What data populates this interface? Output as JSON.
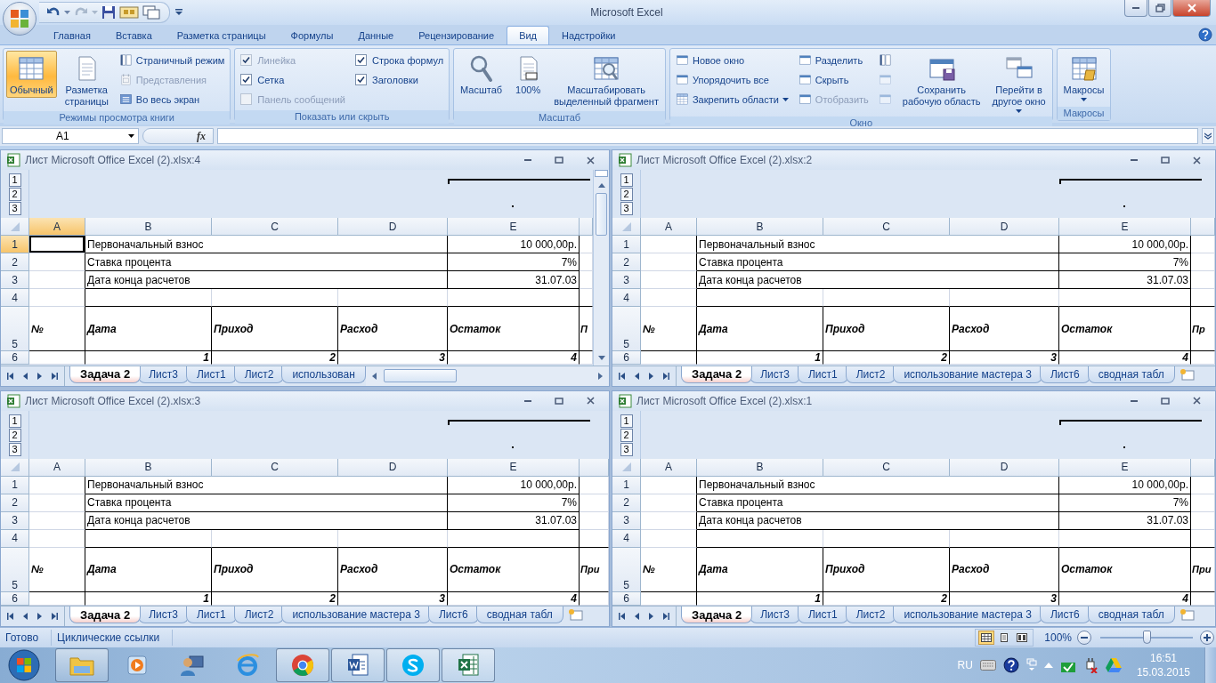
{
  "app": {
    "title": "Microsoft Excel"
  },
  "ribbon_tabs": [
    {
      "label": "Главная",
      "selected": false
    },
    {
      "label": "Вставка",
      "selected": false
    },
    {
      "label": "Разметка страницы",
      "selected": false
    },
    {
      "label": "Формулы",
      "selected": false
    },
    {
      "label": "Данные",
      "selected": false
    },
    {
      "label": "Рецензирование",
      "selected": false
    },
    {
      "label": "Вид",
      "selected": true
    },
    {
      "label": "Надстройки",
      "selected": false
    }
  ],
  "ribbon": {
    "groups": [
      {
        "label": "Режимы просмотра книги",
        "columns": [
          [
            {
              "kind": "large",
              "label": "Обычный",
              "selected": true
            }
          ],
          [
            {
              "kind": "large",
              "label": "Разметка\nстраницы",
              "selected": false
            }
          ],
          [
            {
              "kind": "small",
              "label": "Страничный режим",
              "disabled": false
            },
            {
              "kind": "small",
              "label": "Представления",
              "disabled": true
            },
            {
              "kind": "small",
              "label": "Во весь экран",
              "disabled": false
            }
          ]
        ]
      },
      {
        "label": "Показать или скрыть",
        "columns": [
          [
            {
              "kind": "check",
              "label": "Линейка",
              "checked": true,
              "disabled": true
            },
            {
              "kind": "check",
              "label": "Сетка",
              "checked": true,
              "disabled": false
            },
            {
              "kind": "check",
              "label": "Панель сообщений",
              "checked": false,
              "disabled": true
            }
          ],
          [
            {
              "kind": "check",
              "label": "Строка формул",
              "checked": true,
              "disabled": false
            },
            {
              "kind": "check",
              "label": "Заголовки",
              "checked": true,
              "disabled": false
            }
          ]
        ]
      },
      {
        "label": "Масштаб",
        "columns": [
          [
            {
              "kind": "large",
              "label": "Масштаб"
            }
          ],
          [
            {
              "kind": "large",
              "label": "100%"
            }
          ],
          [
            {
              "kind": "large",
              "label": "Масштабировать\nвыделенный фрагмент"
            }
          ]
        ]
      },
      {
        "label": "Окно",
        "columns": [
          [
            {
              "kind": "small",
              "label": "Новое окно",
              "disabled": false
            },
            {
              "kind": "small",
              "label": "Упорядочить все",
              "disabled": false
            },
            {
              "kind": "small",
              "label": "Закрепить области",
              "disabled": false,
              "dropdown": true
            }
          ],
          [
            {
              "kind": "small",
              "label": "Разделить",
              "disabled": false
            },
            {
              "kind": "small",
              "label": "Скрыть",
              "disabled": false
            },
            {
              "kind": "small",
              "label": "Отобразить",
              "disabled": true
            }
          ],
          [
            {
              "kind": "icon",
              "disabled": false
            },
            {
              "kind": "icon",
              "disabled": true
            },
            {
              "kind": "icon",
              "disabled": true
            }
          ],
          [
            {
              "kind": "large",
              "label": "Сохранить\nрабочую область"
            }
          ],
          [
            {
              "kind": "large",
              "label": "Перейти в\nдругое окно",
              "dropdown": true
            }
          ]
        ]
      },
      {
        "label": "Макросы",
        "columns": [
          [
            {
              "kind": "large",
              "label": "Макросы",
              "dropdown": true
            }
          ]
        ]
      }
    ]
  },
  "formula_bar": {
    "name_box": "A1",
    "function_label": "fx"
  },
  "windows": [
    {
      "title": "Лист Microsoft Office Excel (2).xlsx:4",
      "active": true,
      "vscroll": true,
      "hscroll": true,
      "outline_levels": [
        "1",
        "2",
        "3"
      ],
      "columns": [
        "A",
        "B",
        "C",
        "D",
        "E"
      ],
      "row_numbers": [
        "1",
        "2",
        "3",
        "4",
        "5",
        "6"
      ],
      "info": [
        {
          "label": "Первоначальный взнос",
          "value": "10 000,00р."
        },
        {
          "label": "Ставка процента",
          "value": "7%"
        },
        {
          "label": "Дата конца расчетов",
          "value": "31.07.03"
        }
      ],
      "headings": [
        "№",
        "Дата",
        "Приход",
        "Расход",
        "Остаток",
        "П"
      ],
      "numbers": [
        "1",
        "2",
        "3",
        "4"
      ],
      "sheets": [
        {
          "label": "Задача 2",
          "selected": true
        },
        {
          "label": "Лист3",
          "selected": false
        },
        {
          "label": "Лист1",
          "selected": false
        },
        {
          "label": "Лист2",
          "selected": false
        },
        {
          "label": "использован",
          "selected": false
        }
      ]
    },
    {
      "title": "Лист Microsoft Office Excel (2).xlsx:2",
      "active": false,
      "vscroll": false,
      "hscroll": false,
      "outline_levels": [
        "1",
        "2",
        "3"
      ],
      "columns": [
        "A",
        "B",
        "C",
        "D",
        "E"
      ],
      "row_numbers": [
        "1",
        "2",
        "3",
        "4",
        "5",
        "6"
      ],
      "info": [
        {
          "label": "Первоначальный взнос",
          "value": "10 000,00р."
        },
        {
          "label": "Ставка процента",
          "value": "7%"
        },
        {
          "label": "Дата конца расчетов",
          "value": "31.07.03"
        }
      ],
      "headings": [
        "№",
        "Дата",
        "Приход",
        "Расход",
        "Остаток",
        "Пр"
      ],
      "numbers": [
        "1",
        "2",
        "3",
        "4"
      ],
      "sheets": [
        {
          "label": "Задача 2",
          "selected": true
        },
        {
          "label": "Лист3",
          "selected": false
        },
        {
          "label": "Лист1",
          "selected": false
        },
        {
          "label": "Лист2",
          "selected": false
        },
        {
          "label": "использование мастера 3",
          "selected": false
        },
        {
          "label": "Лист6",
          "selected": false
        },
        {
          "label": "сводная табл",
          "selected": false
        }
      ]
    },
    {
      "title": "Лист Microsoft Office Excel (2).xlsx:3",
      "active": false,
      "vscroll": false,
      "hscroll": false,
      "outline_levels": [
        "1",
        "2",
        "3"
      ],
      "columns": [
        "A",
        "B",
        "C",
        "D",
        "E"
      ],
      "row_numbers": [
        "1",
        "2",
        "3",
        "4",
        "5",
        "6"
      ],
      "info": [
        {
          "label": "Первоначальный взнос",
          "value": "10 000,00р."
        },
        {
          "label": "Ставка процента",
          "value": "7%"
        },
        {
          "label": "Дата конца расчетов",
          "value": "31.07.03"
        }
      ],
      "headings": [
        "№",
        "Дата",
        "Приход",
        "Расход",
        "Остаток",
        "При"
      ],
      "numbers": [
        "1",
        "2",
        "3",
        "4"
      ],
      "sheets": [
        {
          "label": "Задача 2",
          "selected": true
        },
        {
          "label": "Лист3",
          "selected": false
        },
        {
          "label": "Лист1",
          "selected": false
        },
        {
          "label": "Лист2",
          "selected": false
        },
        {
          "label": "использование мастера 3",
          "selected": false
        },
        {
          "label": "Лист6",
          "selected": false
        },
        {
          "label": "сводная табл",
          "selected": false
        }
      ]
    },
    {
      "title": "Лист Microsoft Office Excel (2).xlsx:1",
      "active": false,
      "vscroll": false,
      "hscroll": false,
      "outline_levels": [
        "1",
        "2",
        "3"
      ],
      "columns": [
        "A",
        "B",
        "C",
        "D",
        "E"
      ],
      "row_numbers": [
        "1",
        "2",
        "3",
        "4",
        "5",
        "6"
      ],
      "info": [
        {
          "label": "Первоначальный взнос",
          "value": "10 000,00р."
        },
        {
          "label": "Ставка процента",
          "value": "7%"
        },
        {
          "label": "Дата конца расчетов",
          "value": "31.07.03"
        }
      ],
      "headings": [
        "№",
        "Дата",
        "Приход",
        "Расход",
        "Остаток",
        "При"
      ],
      "numbers": [
        "1",
        "2",
        "3",
        "4"
      ],
      "sheets": [
        {
          "label": "Задача 2",
          "selected": true
        },
        {
          "label": "Лист3",
          "selected": false
        },
        {
          "label": "Лист1",
          "selected": false
        },
        {
          "label": "Лист2",
          "selected": false
        },
        {
          "label": "использование мастера 3",
          "selected": false
        },
        {
          "label": "Лист6",
          "selected": false
        },
        {
          "label": "сводная табл",
          "selected": false
        }
      ]
    }
  ],
  "status_bar": {
    "items": [
      "Готово",
      "Циклические ссылки"
    ],
    "view_buttons": [
      {
        "selected": true
      },
      {
        "selected": false
      },
      {
        "selected": false
      }
    ],
    "zoom": "100%",
    "zoom_slider": {
      "level": 0.5
    }
  },
  "taskbar": {
    "apps": [
      {
        "running": true
      },
      {
        "running": false
      },
      {
        "running": false
      },
      {
        "running": false
      },
      {
        "running": true
      },
      {
        "running": true
      },
      {
        "running": true
      },
      {
        "running": true
      }
    ],
    "tray": {
      "language": "RU",
      "time": "16:51",
      "date": "15.03.2015"
    }
  }
}
